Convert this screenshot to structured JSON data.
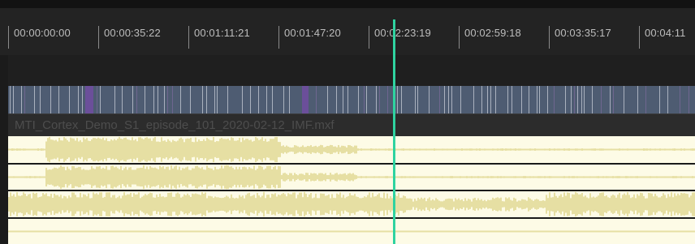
{
  "ruler": {
    "timecodes": [
      "00:00:00:00",
      "00:00:35:22",
      "00:01:11:21",
      "00:01:47:20",
      "00:02:23:19",
      "00:02:59:18",
      "00:03:35:17",
      "00:04:11"
    ]
  },
  "clip": {
    "filename": "MTI_Cortex_Demo_S1_episode_101_2020-02-12_IMF.mxf"
  },
  "colors": {
    "background": "#1b1b1b",
    "video_track": "#4e5c72",
    "audio_track": "#fdfbe6",
    "waveform": "#e6dfa3",
    "playhead": "#2fd3a0"
  },
  "tracks": {
    "audio_count": 4
  }
}
